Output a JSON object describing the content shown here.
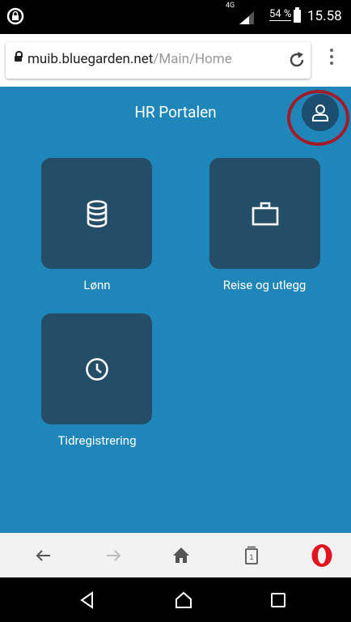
{
  "status_bar": {
    "network": "4G",
    "battery": "54 %",
    "time": "15.58"
  },
  "address_bar": {
    "domain": "muib.bluegarden.net",
    "path": "/Main/Home"
  },
  "page": {
    "title": "HR Portalen",
    "tiles": [
      {
        "label": "Lønn",
        "icon": "coins-icon"
      },
      {
        "label": "Reise og utlegg",
        "icon": "briefcase-icon"
      },
      {
        "label": "Tidregistrering",
        "icon": "clock-icon"
      }
    ]
  },
  "browser_bar": {
    "tab_count": "1"
  },
  "colors": {
    "page_background": "#1f86b9",
    "tile_background": "#244e68",
    "profile_button": "#1b4e6f",
    "highlight_ring": "#a01c2b",
    "opera_red": "#e0151f"
  }
}
